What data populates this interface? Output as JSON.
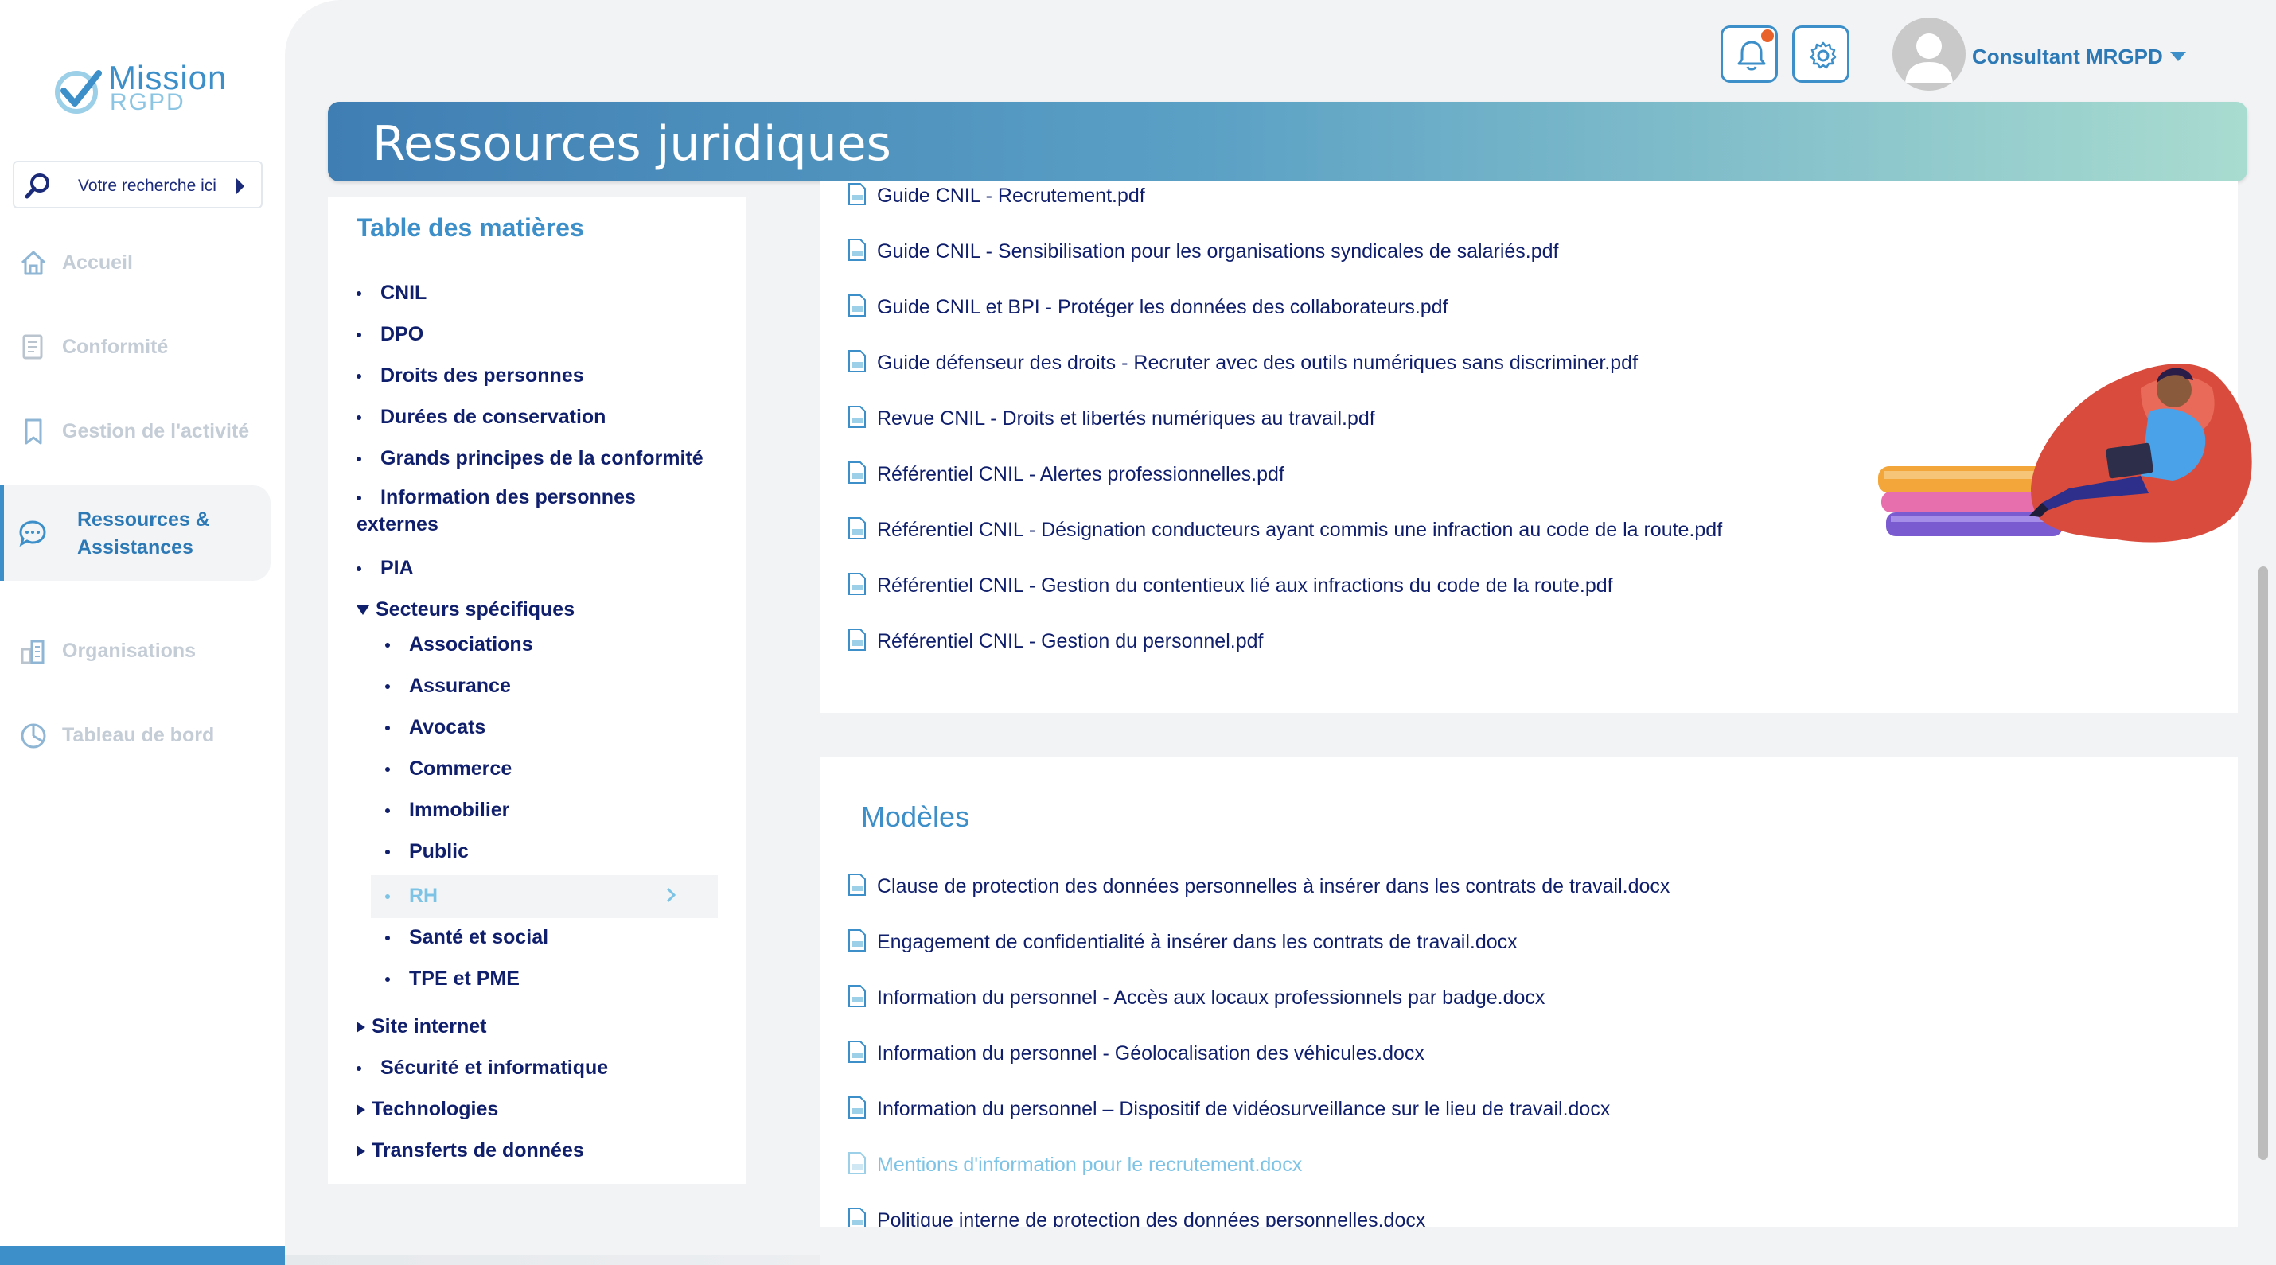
{
  "app": {
    "logo_line1": "Mission",
    "logo_line2": "RGPD",
    "colors": {
      "accent": "#3d8fc9",
      "navy": "#101f6b",
      "muted": "#c4ccd6",
      "notification": "#e8622a"
    }
  },
  "search": {
    "placeholder": "Votre recherche ici"
  },
  "sidebar": {
    "items": [
      {
        "label": "Accueil",
        "icon": "home-icon"
      },
      {
        "label": "Conformité",
        "icon": "document-icon"
      },
      {
        "label": "Gestion de l'activité",
        "icon": "bookmark-icon"
      },
      {
        "label": "Ressources & Assistances",
        "icon": "chat-icon",
        "active": true
      },
      {
        "label": "Organisations",
        "icon": "buildings-icon"
      },
      {
        "label": "Tableau de bord",
        "icon": "pie-chart-icon"
      }
    ]
  },
  "header": {
    "user_name": "Consultant MRGPD",
    "icons": [
      "bell-icon",
      "gear-icon",
      "avatar",
      "caret-down-icon"
    ]
  },
  "banner": {
    "title": "Ressources juridiques"
  },
  "toc": {
    "title": "Table des matières",
    "items": [
      "CNIL",
      "DPO",
      "Droits des personnes",
      "Durées de conservation",
      "Grands principes de la conformité",
      "Information des personnes externes",
      "PIA",
      "Secteurs spécifiques"
    ],
    "sub_items": [
      "Associations",
      "Assurance",
      "Avocats",
      "Commerce",
      "Immobilier",
      "Public",
      "RH",
      "Santé et social",
      "TPE et PME"
    ],
    "active_sub_item": "RH",
    "bottom_items": [
      "Site internet",
      "Sécurité et informatique",
      "Technologies",
      "Transferts de données"
    ]
  },
  "documents": {
    "guides": [
      "Guide CNIL - Recrutement.pdf",
      "Guide CNIL - Sensibilisation pour les organisations syndicales de salariés.pdf",
      "Guide CNIL et BPI - Protéger les données des collaborateurs.pdf",
      "Guide défenseur des droits - Recruter avec des outils numériques sans discriminer.pdf",
      "Revue CNIL - Droits et libertés numériques au travail.pdf",
      "Référentiel CNIL - Alertes professionnelles.pdf",
      "Référentiel CNIL - Désignation conducteurs ayant commis une infraction au code de la route.pdf",
      "Référentiel CNIL - Gestion du contentieux lié aux infractions du code de la route.pdf",
      "Référentiel CNIL - Gestion du personnel.pdf"
    ],
    "models_title": "Modèles",
    "models": [
      "Clause de protection des données personnelles à insérer dans les contrats de travail.docx",
      "Engagement de confidentialité à insérer dans les contrats de travail.docx",
      "Information du personnel - Accès aux locaux professionnels par badge.docx",
      "Information du personnel - Géolocalisation des véhicules.docx",
      "Information du personnel – Dispositif de vidéosurveillance sur le lieu de travail.docx",
      "Mentions d'information pour le recrutement.docx",
      "Politique interne de protection des données personnelles.docx"
    ]
  }
}
